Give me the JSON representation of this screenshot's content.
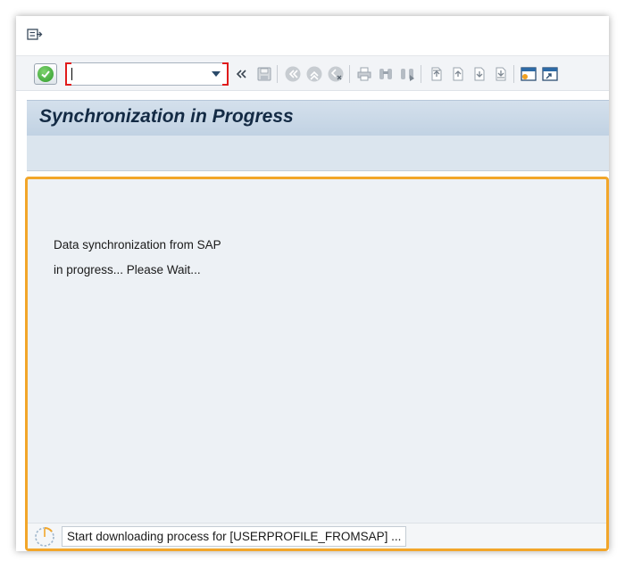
{
  "header": {
    "menu_icon": "menu-exit-icon"
  },
  "toolbar": {
    "command_field": {
      "value": "",
      "placeholder": ""
    },
    "icons": [
      "enter-check-icon",
      "command-dropdown-icon",
      "collapse-double-chevron-icon",
      "save-icon",
      "back-icon",
      "exit-icon",
      "cancel-icon",
      "print-icon",
      "find-icon",
      "find-next-icon",
      "first-page-icon",
      "previous-page-icon",
      "next-page-icon",
      "last-page-icon",
      "new-session-icon",
      "create-shortcut-icon"
    ]
  },
  "page": {
    "title": "Synchronization in Progress"
  },
  "content": {
    "message_line1": "Data synchronization from SAP",
    "message_line2": "in progress... Please Wait..."
  },
  "status": {
    "text": "Start downloading process for [USERPROFILE_FROMSAP] ...",
    "icon": "loading-spinner-icon"
  },
  "colors": {
    "accent_border": "#f2a62a",
    "title_bg": "#c1d2e3",
    "title_text": "#132a44",
    "command_bracket": "#e01b1b",
    "ok_green": "#2e9b2a"
  }
}
